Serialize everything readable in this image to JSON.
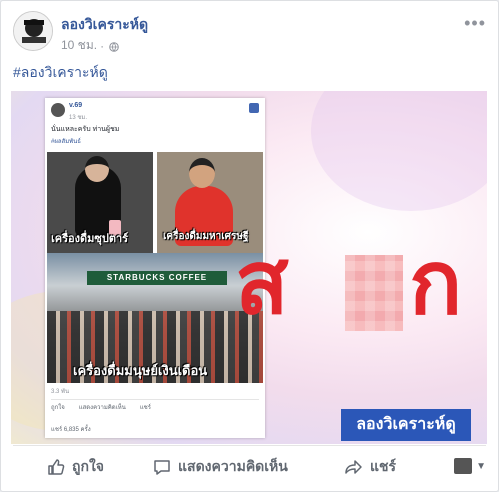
{
  "post": {
    "page_name": "ลองวิเคราะห์ดู",
    "time": "10 ชม.",
    "separator": "·",
    "hashtag": "#ลองวิเคราะห์ดู"
  },
  "image": {
    "inner_post": {
      "name": "v.69",
      "time": "13 ชม.",
      "text": "นั่นแหละครับ ท่านผู้ชม",
      "tag": "#ผลสัมพันธ์",
      "sign": "STARBUCKS COFFEE",
      "caption1": "เครื่องดื่มซุปตาร์",
      "caption2": "เครื่องดื่มมหาเศรษฐี",
      "caption3": "เครื่องดื่มมนุษย์เงินเดือน",
      "stats": "3.3 พัน",
      "actions": [
        "ถูกใจ",
        "แสดงความคิดเห็น",
        "แชร์"
      ],
      "shares": "แชร์ 6,835 ครั้ง"
    },
    "big_text_left": "ส",
    "big_text_right": "ก",
    "brand_label": "ลองวิเคราะห์ดู"
  },
  "actions": {
    "like": "ถูกใจ",
    "comment": "แสดงความคิดเห็น",
    "share": "แชร์"
  },
  "icons": {
    "like": "thumbs-up-icon",
    "comment": "comment-icon",
    "share": "share-arrow-icon",
    "more": "more-dots-icon",
    "privacy": "globe-icon"
  },
  "colors": {
    "link": "#365899",
    "big_text": "#e1262c",
    "brand_box": "#2b57b8"
  }
}
